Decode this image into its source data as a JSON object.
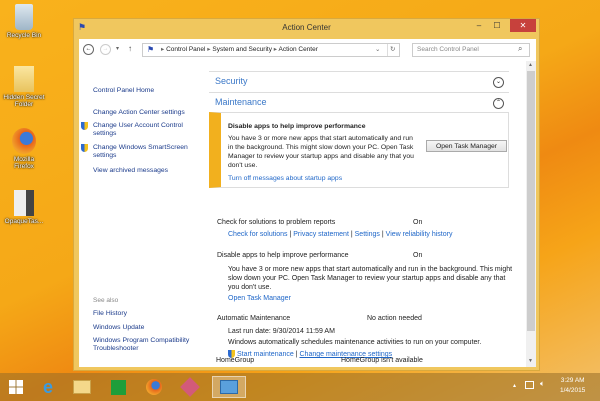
{
  "desktop": {
    "icons": [
      {
        "label": "Recycle Bin"
      },
      {
        "label": "Hidden Secret Folder"
      },
      {
        "label": "Mozilla Firefox"
      },
      {
        "label": "OpaqueTas..."
      }
    ]
  },
  "window": {
    "title": "Action Center",
    "minimize": "–",
    "maximize": "☐",
    "close": "✕"
  },
  "nav": {
    "back": "←",
    "forward": "→",
    "recent": "▾",
    "up": "↑",
    "breadcrumb": [
      "Control Panel",
      "System and Security",
      "Action Center"
    ],
    "refresh": "↻",
    "dropdown": "⌄",
    "search_placeholder": "Search Control Panel",
    "search_icon": "⌕"
  },
  "sidebar": {
    "home": "Control Panel Home",
    "links": [
      "Change Action Center settings",
      "Change User Account Control settings",
      "Change Windows SmartScreen settings",
      "View archived messages"
    ],
    "see_also_label": "See also",
    "see_also": [
      "File History",
      "Windows Update",
      "Windows Program Compatibility Troubleshooter"
    ]
  },
  "main": {
    "security": "Security",
    "maintenance": "Maintenance",
    "alert": {
      "title": "Disable apps to help improve performance",
      "text": "You have 3 or more new apps that start automatically and run in the background. This might slow down your PC. Open Task Manager to review your startup apps and disable any that you don't use.",
      "button": "Open Task Manager",
      "link": "Turn off messages about startup apps",
      "accent": "#f2b01e"
    },
    "problem_reports": {
      "label": "Check for solutions to problem reports",
      "status": "On",
      "links": [
        "Check for solutions",
        "Privacy statement",
        "Settings",
        "View reliability history"
      ]
    },
    "disable_apps": {
      "label": "Disable apps to help improve performance",
      "status": "On",
      "text": "You have 3 or more new apps that start automatically and run in the background. This might slow down your PC. Open Task Manager to review your startup apps and disable any that you don't use.",
      "link": "Open Task Manager"
    },
    "auto_maint": {
      "label": "Automatic Maintenance",
      "status": "No action needed",
      "last_run": "Last run date: 9/30/2014 11:59 AM",
      "text": "Windows automatically schedules maintenance activities to run on your computer.",
      "links": [
        "Start maintenance",
        "Change maintenance settings"
      ]
    },
    "homegroup": {
      "label": "HomeGroup",
      "status": "HomeGroup isn't available"
    },
    "separator": "|"
  },
  "taskbar": {
    "time": "3:29 AM",
    "date": "1/4/2015"
  }
}
